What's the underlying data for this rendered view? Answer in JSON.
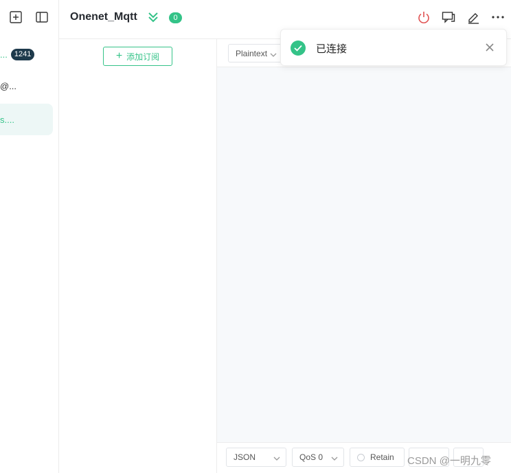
{
  "colors": {
    "accent": "#34c388",
    "danger": "#e05252",
    "badge_dark": "#1e3a4c"
  },
  "sidebar": {
    "icons": [
      "new-connection-icon",
      "toggle-sidebar-icon"
    ],
    "items": [
      {
        "label": "...",
        "badge": "1241"
      },
      {
        "label": "@..."
      },
      {
        "label": "s....",
        "active": true
      }
    ]
  },
  "header": {
    "title": "Onenet_Mqtt",
    "count": "0",
    "actions": [
      "disconnect-icon",
      "new-window-icon",
      "edit-icon",
      "more-icon"
    ]
  },
  "subscriptions": {
    "add_label": "添加订阅"
  },
  "messages": {
    "payload_format": "Plaintext"
  },
  "footer": {
    "payload_type": "JSON",
    "qos": "QoS 0",
    "retain_label": "Retain"
  },
  "toast": {
    "message": "已连接"
  },
  "watermark": "CSDN @一明九零"
}
